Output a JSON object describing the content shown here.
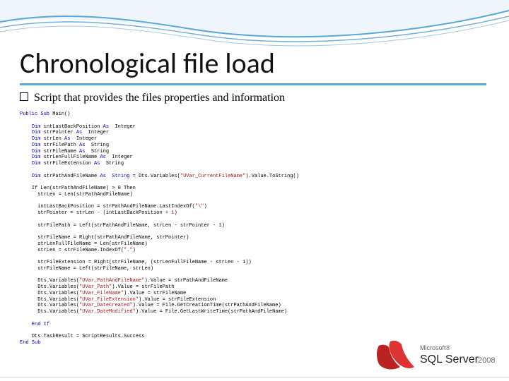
{
  "title": "Chronological file load",
  "bullet": "Script that provides the files properties and information",
  "logo": {
    "vendor": "Microsoft®",
    "product": "SQL Server",
    "year": "2008"
  },
  "code": {
    "dim": "Dim ",
    "as": " As ",
    "str2": " String",
    "endif": "End If",
    "endsub": "End Sub",
    "l0a": "Public Sub ",
    "l0b": "Main()",
    "l1a": "intLastBackPosition",
    "l1b": " Integer",
    "l2a": "strPointer",
    "l2b": " Integer",
    "l3a": "strLen",
    "l3b": " Integer",
    "l4a": "strFilePath",
    "l4b": " String",
    "l5a": "strFileName",
    "l5b": " String",
    "l6a": "strLenFullFileName",
    "l6b": " Integer",
    "l7a": "strFileExtension",
    "l7b": " String",
    "l8a": "strPathAndFileName",
    "l8b": " = Dts.Variables(",
    "s1": "\"UVar_CurrentFileName\"",
    "l8c": ").Value.ToString()",
    "l9": "If Len(strPathAndFileName) > 0 Then",
    "l10": "strLen = Len(strPathAndFileName)",
    "l11a": "intLastBackPosition = strPathAndFileName.LastIndexOf(",
    "s2": "\"\\\"",
    "l11b": ")",
    "l12a": "strPointer = strLen - (intLastBackPosition + ",
    "s3": "1",
    "l12b": ")",
    "l13": "strFilePath = Left(strPathAndFileName, strLen - strPointer - 1)",
    "l14": "strFileName = Right(strPathAndFileName, strPointer)",
    "l15": "strLenFullFileName = Len(strFileName)",
    "l16a": "strLen = strFileName.IndexOf(",
    "s4": "\".\"",
    "l16b": ")",
    "l17": "strFileExtension = Right(strFileName, (strLenFullFileName - strLen - 1))",
    "l18": "strFileName = Left(strFileName, strLen)",
    "l19a": "Dts.Variables(",
    "s5a": "\"UVar_PathAndFileName\"",
    "l19b": ").Value = strPathAndFileName",
    "l20a": "Dts.Variables(",
    "s5b": "\"UVar_Path\"",
    "l20b": ").Value = strFilePath",
    "l21a": "Dts.Variables(",
    "s5c": "\"UVar_FileName\"",
    "l21b": ").Value = strFileName",
    "l22a": "Dts.Variables(",
    "s5d": "\"UVar_FileExtension\"",
    "l22b": ").Value = strFileExtension",
    "l23a": "Dts.Variables(",
    "s5e": "\"UVar_DateCreated\"",
    "l23b": ").Value = File.GetCreationTime(strPathAndFileName)",
    "l24a": "Dts.Variables(",
    "s5f": "\"UVar_DateModified\"",
    "l24b": ").Value = File.GetLastWriteTime(strPathAndFileName)",
    "l25": "Dts.TaskResult = ScriptResults.Success"
  }
}
